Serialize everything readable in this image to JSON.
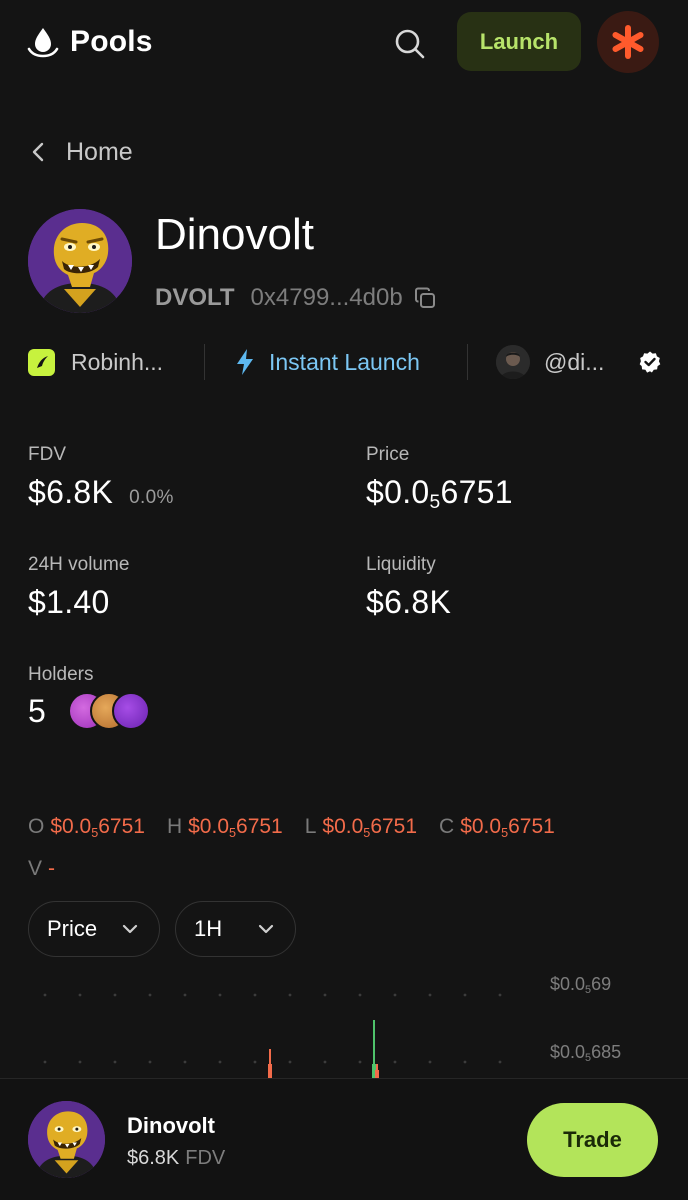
{
  "header": {
    "logo_text": "Pools",
    "launch_label": "Launch",
    "icons": [
      "pools-logo-icon",
      "search-icon",
      "asterisk-avatar-icon"
    ],
    "accent_color": "#b7e36a"
  },
  "breadcrumb": {
    "back_label": "Home"
  },
  "token": {
    "name": "Dinovolt",
    "symbol": "DVOLT",
    "address": "0x4799...4d0b"
  },
  "tags": {
    "platform": "Robinh...",
    "launch_type": "Instant Launch",
    "creator": "@di..."
  },
  "stats": {
    "fdv_label": "FDV",
    "fdv_value": "$6.8K",
    "fdv_change": "0.0%",
    "price_label": "Price",
    "price_prefix": "$0.0",
    "price_sub": "5",
    "price_rest": "6751",
    "volume_label": "24H volume",
    "volume_value": "$1.40",
    "liquidity_label": "Liquidity",
    "liquidity_value": "$6.8K",
    "holders_label": "Holders",
    "holders_value": "5"
  },
  "ohlc": {
    "o_label": "O",
    "h_label": "H",
    "l_label": "L",
    "c_label": "C",
    "v_label": "V",
    "prefix": "$0.0",
    "sub": "5",
    "rest": "6751",
    "v_value": "-",
    "color": "#f26b4a"
  },
  "selectors": {
    "metric": "Price",
    "interval": "1H"
  },
  "chart_axis": {
    "tick1_prefix": "$0.0",
    "tick1_sub": "5",
    "tick1_rest": "69",
    "tick2_prefix": "$0.0",
    "tick2_sub": "5",
    "tick2_rest": "685"
  },
  "bottom_bar": {
    "name": "Dinovolt",
    "fdv_value": "$6.8K",
    "fdv_unit": "FDV",
    "trade_label": "Trade"
  }
}
